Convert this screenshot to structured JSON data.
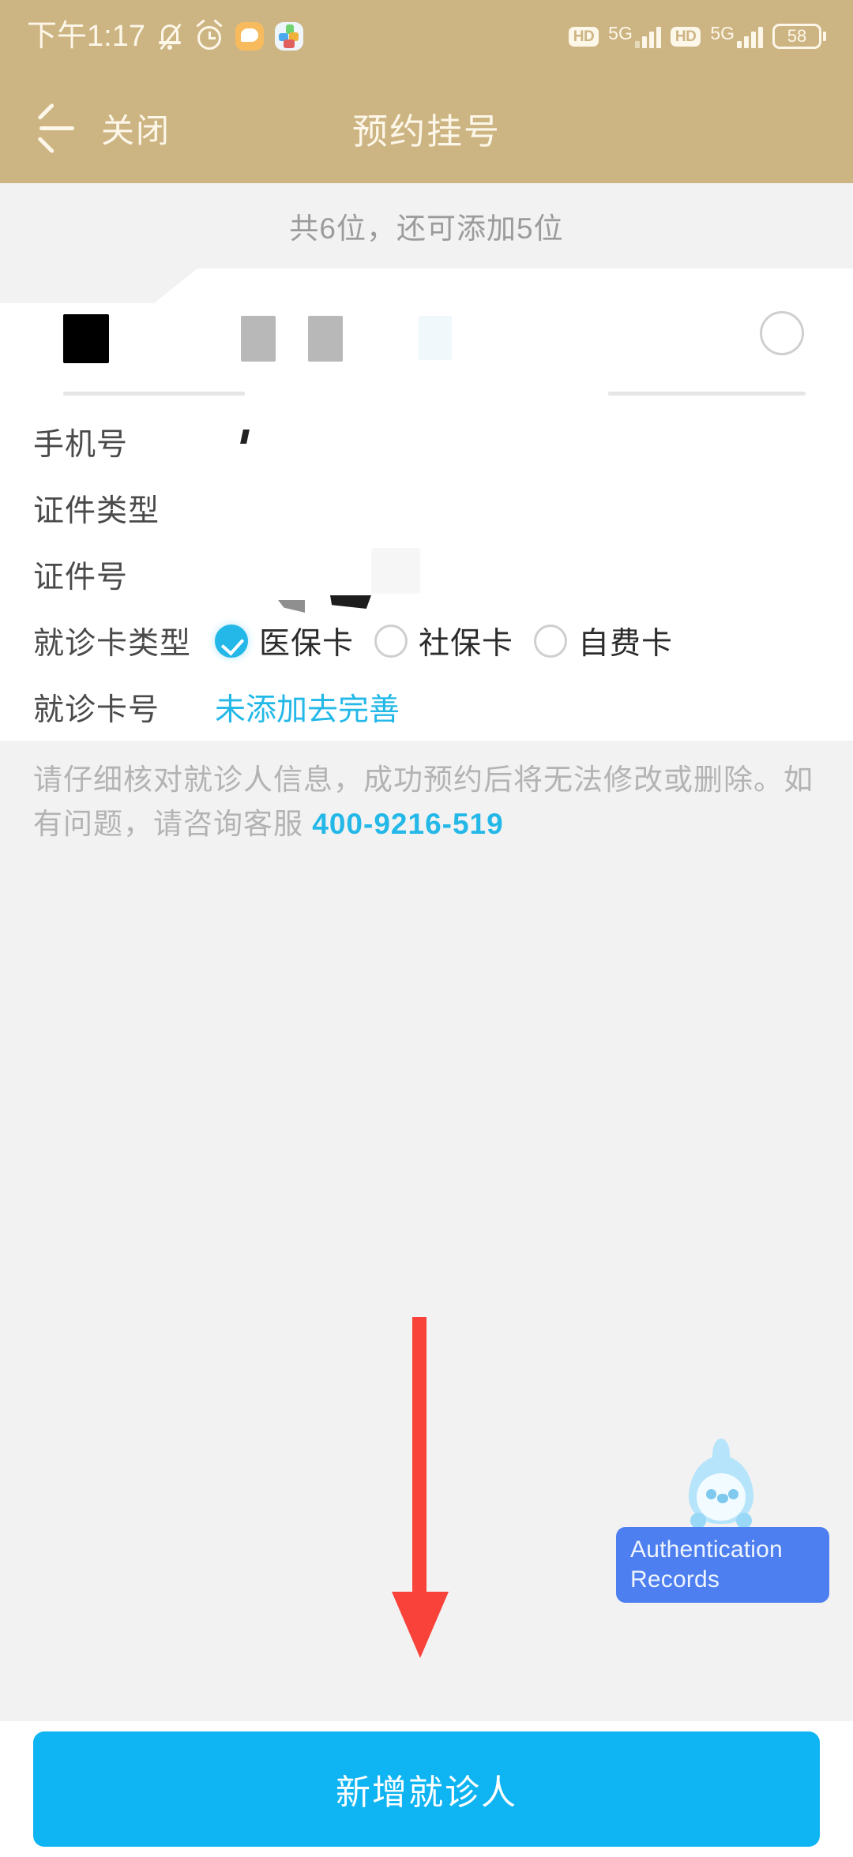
{
  "statusbar": {
    "time": "下午1:17",
    "icons": [
      "mute-bell-icon",
      "alarm-clock-icon",
      "chat-bubble-icon",
      "photos-app-icon"
    ],
    "hd_badge_1": "HD",
    "network_1": "5G",
    "hd_badge_2": "HD",
    "network_2": "5G",
    "battery_level": "58"
  },
  "navbar": {
    "back_icon": "back-arrow-icon",
    "close_label": "关闭",
    "title": "预约挂号"
  },
  "count_bar": {
    "text": "共6位，还可添加5位"
  },
  "patient_card": {
    "name_value": "",
    "selected": false,
    "fields": [
      {
        "label": "手机号",
        "value": ""
      },
      {
        "label": "证件类型",
        "value": ""
      },
      {
        "label": "证件号",
        "value": ""
      }
    ],
    "card_type": {
      "label": "就诊卡类型",
      "options": [
        {
          "label": "医保卡",
          "checked": true
        },
        {
          "label": "社保卡",
          "checked": false
        },
        {
          "label": "自费卡",
          "checked": false
        }
      ]
    },
    "card_number": {
      "label": "就诊卡号",
      "link_text": "未添加去完善"
    }
  },
  "notice": {
    "text_part1": "请仔细核对就诊人信息，成功预约后将无法修改或删除。如有问题，请咨询客服 ",
    "phone": "400-9216-519"
  },
  "annotation": {
    "arrow": "red-down-arrow"
  },
  "auth_widget": {
    "line1": "Authentication",
    "line2": "Records",
    "mascot": "penguin-mascot-icon"
  },
  "bottom": {
    "add_patient_label": "新增就诊人"
  },
  "colors": {
    "header": "#cdb583",
    "accent_blue": "#23b8e8",
    "button_blue": "#0fb4f2",
    "widget_blue": "#4d7ff0",
    "arrow_red": "#f9423a",
    "page_bg": "#f2f2f2"
  }
}
